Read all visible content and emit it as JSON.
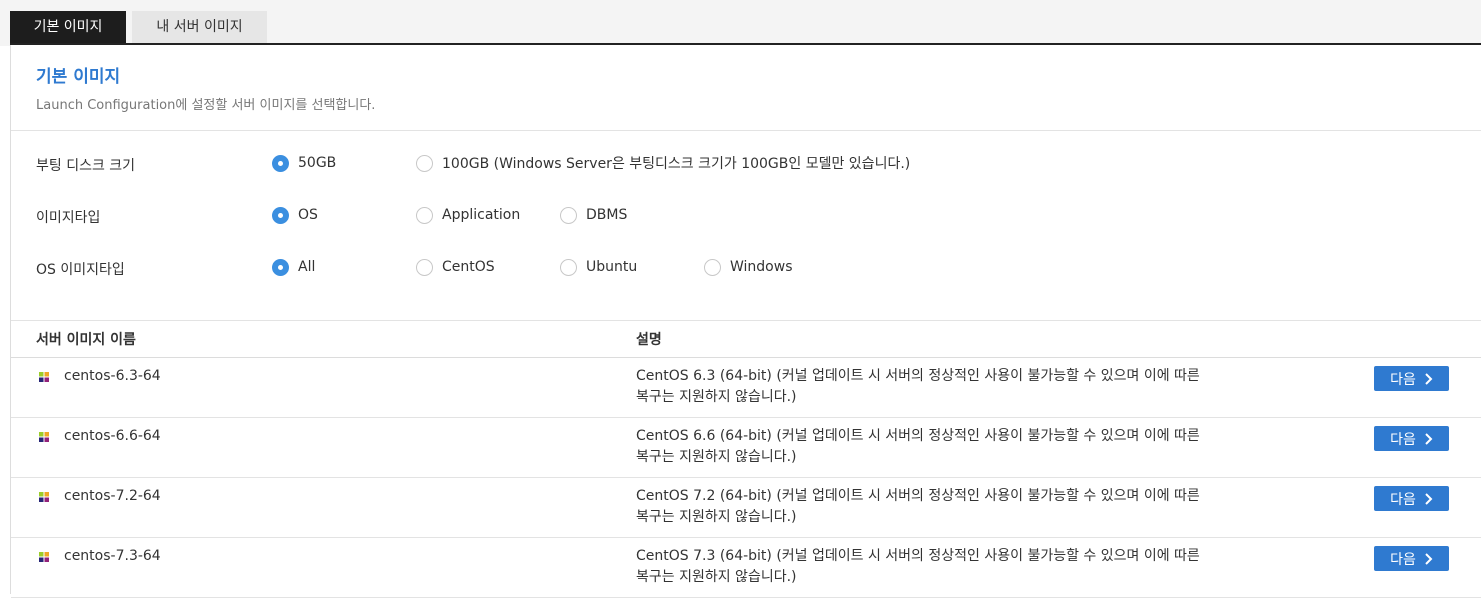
{
  "tabs": [
    {
      "label": "기본 이미지",
      "active": true
    },
    {
      "label": "내 서버 이미지",
      "active": false
    }
  ],
  "header": {
    "title": "기본 이미지",
    "subtitle": "Launch Configuration에 설정할 서버 이미지를 선택합니다."
  },
  "options": {
    "boot_disk": {
      "label": "부팅 디스크 크기",
      "choices": [
        "50GB",
        "100GB (Windows Server은 부팅디스크 크기가 100GB인 모델만 있습니다.)"
      ],
      "selected": "50GB"
    },
    "image_type": {
      "label": "이미지타입",
      "choices": [
        "OS",
        "Application",
        "DBMS"
      ],
      "selected": "OS"
    },
    "os_image_type": {
      "label": "OS 이미지타입",
      "choices": [
        "All",
        "CentOS",
        "Ubuntu",
        "Windows"
      ],
      "selected": "All"
    }
  },
  "table": {
    "columns": [
      "서버 이미지 이름",
      "설명"
    ],
    "next_label": "다음",
    "rows": [
      {
        "name": "centos-6.3-64",
        "desc_line1": "CentOS 6.3 (64-bit) (커널 업데이트 시 서버의 정상적인 사용이 불가능할 수 있으며 이에 따른",
        "desc_line2": "복구는 지원하지 않습니다.)"
      },
      {
        "name": "centos-6.6-64",
        "desc_line1": "CentOS 6.6 (64-bit) (커널 업데이트 시 서버의 정상적인 사용이 불가능할 수 있으며 이에 따른",
        "desc_line2": "복구는 지원하지 않습니다.)"
      },
      {
        "name": "centos-7.2-64",
        "desc_line1": "CentOS 7.2 (64-bit) (커널 업데이트 시 서버의 정상적인 사용이 불가능할 수 있으며 이에 따른",
        "desc_line2": "복구는 지원하지 않습니다.)"
      },
      {
        "name": "centos-7.3-64",
        "desc_line1": "CentOS 7.3 (64-bit) (커널 업데이트 시 서버의 정상적인 사용이 불가능할 수 있으며 이에 따른",
        "desc_line2": "복구는 지원하지 않습니다.)"
      }
    ]
  },
  "colors": {
    "accent": "#2f7ad0",
    "radio_checked": "#3b8fe0",
    "active_tab": "#1d1d1d"
  },
  "icons": {
    "os_icon": "centos-icon",
    "next_icon": "chevron-right-icon"
  }
}
